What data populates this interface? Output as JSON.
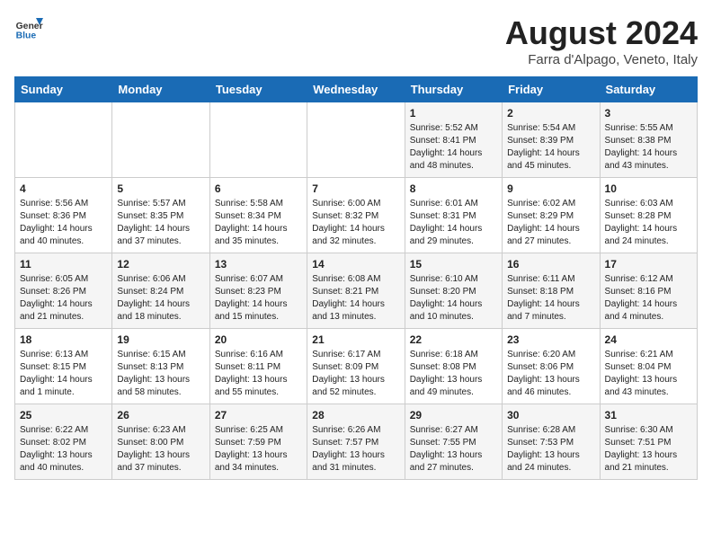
{
  "header": {
    "logo_line1": "General",
    "logo_line2": "Blue",
    "month_year": "August 2024",
    "location": "Farra d'Alpago, Veneto, Italy"
  },
  "days_of_week": [
    "Sunday",
    "Monday",
    "Tuesday",
    "Wednesday",
    "Thursday",
    "Friday",
    "Saturday"
  ],
  "weeks": [
    [
      {
        "day": "",
        "info": ""
      },
      {
        "day": "",
        "info": ""
      },
      {
        "day": "",
        "info": ""
      },
      {
        "day": "",
        "info": ""
      },
      {
        "day": "1",
        "info": "Sunrise: 5:52 AM\nSunset: 8:41 PM\nDaylight: 14 hours and 48 minutes."
      },
      {
        "day": "2",
        "info": "Sunrise: 5:54 AM\nSunset: 8:39 PM\nDaylight: 14 hours and 45 minutes."
      },
      {
        "day": "3",
        "info": "Sunrise: 5:55 AM\nSunset: 8:38 PM\nDaylight: 14 hours and 43 minutes."
      }
    ],
    [
      {
        "day": "4",
        "info": "Sunrise: 5:56 AM\nSunset: 8:36 PM\nDaylight: 14 hours and 40 minutes."
      },
      {
        "day": "5",
        "info": "Sunrise: 5:57 AM\nSunset: 8:35 PM\nDaylight: 14 hours and 37 minutes."
      },
      {
        "day": "6",
        "info": "Sunrise: 5:58 AM\nSunset: 8:34 PM\nDaylight: 14 hours and 35 minutes."
      },
      {
        "day": "7",
        "info": "Sunrise: 6:00 AM\nSunset: 8:32 PM\nDaylight: 14 hours and 32 minutes."
      },
      {
        "day": "8",
        "info": "Sunrise: 6:01 AM\nSunset: 8:31 PM\nDaylight: 14 hours and 29 minutes."
      },
      {
        "day": "9",
        "info": "Sunrise: 6:02 AM\nSunset: 8:29 PM\nDaylight: 14 hours and 27 minutes."
      },
      {
        "day": "10",
        "info": "Sunrise: 6:03 AM\nSunset: 8:28 PM\nDaylight: 14 hours and 24 minutes."
      }
    ],
    [
      {
        "day": "11",
        "info": "Sunrise: 6:05 AM\nSunset: 8:26 PM\nDaylight: 14 hours and 21 minutes."
      },
      {
        "day": "12",
        "info": "Sunrise: 6:06 AM\nSunset: 8:24 PM\nDaylight: 14 hours and 18 minutes."
      },
      {
        "day": "13",
        "info": "Sunrise: 6:07 AM\nSunset: 8:23 PM\nDaylight: 14 hours and 15 minutes."
      },
      {
        "day": "14",
        "info": "Sunrise: 6:08 AM\nSunset: 8:21 PM\nDaylight: 14 hours and 13 minutes."
      },
      {
        "day": "15",
        "info": "Sunrise: 6:10 AM\nSunset: 8:20 PM\nDaylight: 14 hours and 10 minutes."
      },
      {
        "day": "16",
        "info": "Sunrise: 6:11 AM\nSunset: 8:18 PM\nDaylight: 14 hours and 7 minutes."
      },
      {
        "day": "17",
        "info": "Sunrise: 6:12 AM\nSunset: 8:16 PM\nDaylight: 14 hours and 4 minutes."
      }
    ],
    [
      {
        "day": "18",
        "info": "Sunrise: 6:13 AM\nSunset: 8:15 PM\nDaylight: 14 hours and 1 minute."
      },
      {
        "day": "19",
        "info": "Sunrise: 6:15 AM\nSunset: 8:13 PM\nDaylight: 13 hours and 58 minutes."
      },
      {
        "day": "20",
        "info": "Sunrise: 6:16 AM\nSunset: 8:11 PM\nDaylight: 13 hours and 55 minutes."
      },
      {
        "day": "21",
        "info": "Sunrise: 6:17 AM\nSunset: 8:09 PM\nDaylight: 13 hours and 52 minutes."
      },
      {
        "day": "22",
        "info": "Sunrise: 6:18 AM\nSunset: 8:08 PM\nDaylight: 13 hours and 49 minutes."
      },
      {
        "day": "23",
        "info": "Sunrise: 6:20 AM\nSunset: 8:06 PM\nDaylight: 13 hours and 46 minutes."
      },
      {
        "day": "24",
        "info": "Sunrise: 6:21 AM\nSunset: 8:04 PM\nDaylight: 13 hours and 43 minutes."
      }
    ],
    [
      {
        "day": "25",
        "info": "Sunrise: 6:22 AM\nSunset: 8:02 PM\nDaylight: 13 hours and 40 minutes."
      },
      {
        "day": "26",
        "info": "Sunrise: 6:23 AM\nSunset: 8:00 PM\nDaylight: 13 hours and 37 minutes."
      },
      {
        "day": "27",
        "info": "Sunrise: 6:25 AM\nSunset: 7:59 PM\nDaylight: 13 hours and 34 minutes."
      },
      {
        "day": "28",
        "info": "Sunrise: 6:26 AM\nSunset: 7:57 PM\nDaylight: 13 hours and 31 minutes."
      },
      {
        "day": "29",
        "info": "Sunrise: 6:27 AM\nSunset: 7:55 PM\nDaylight: 13 hours and 27 minutes."
      },
      {
        "day": "30",
        "info": "Sunrise: 6:28 AM\nSunset: 7:53 PM\nDaylight: 13 hours and 24 minutes."
      },
      {
        "day": "31",
        "info": "Sunrise: 6:30 AM\nSunset: 7:51 PM\nDaylight: 13 hours and 21 minutes."
      }
    ]
  ]
}
